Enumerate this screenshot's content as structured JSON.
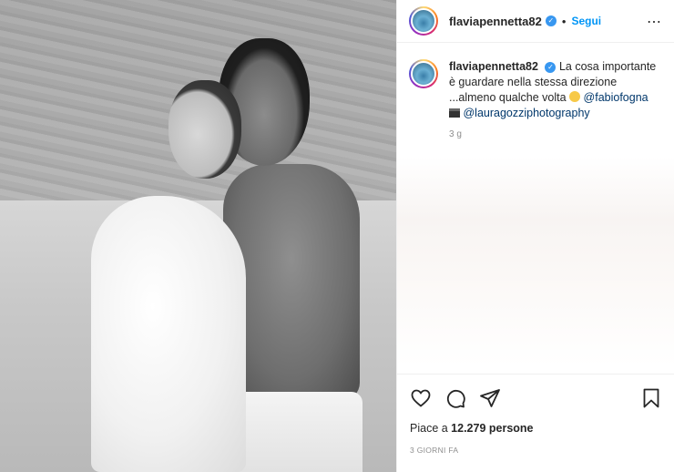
{
  "post": {
    "username": "flaviapennetta82",
    "verified": true,
    "follow_label": "Segui",
    "more_icon": "more-options-icon",
    "caption": {
      "username": "flaviapennetta82",
      "text_line1": "La cosa importante",
      "text_line2": "è guardare nella stessa direzione",
      "text_line3": "...almeno qualche volta",
      "mention1": "@fabiofogna",
      "mention2": "@lauragozziphotography"
    },
    "age": "3 g",
    "likes_prefix": "Piace a ",
    "likes_count": "12.279 persone",
    "timestamp": "3 GIORNI FA",
    "icons": [
      "heart-icon",
      "comment-icon",
      "share-icon",
      "bookmark-icon"
    ],
    "colors": {
      "link": "#00376b",
      "follow": "#0095f6",
      "verified": "#3897f0"
    }
  }
}
